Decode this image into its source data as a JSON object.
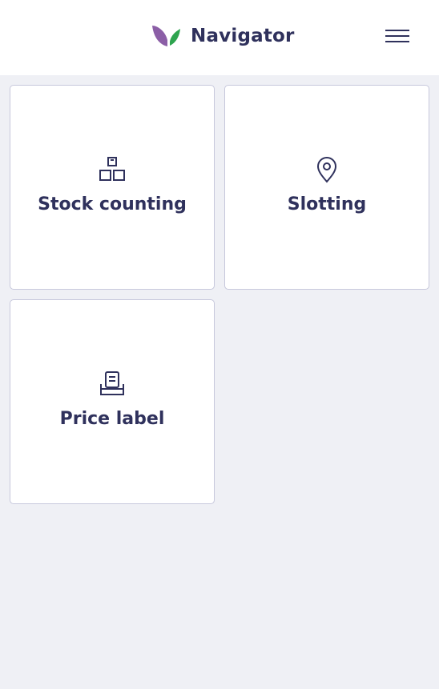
{
  "header": {
    "brand_name": "Navigator",
    "logo_icon": "leaf-logo",
    "menu_icon": "hamburger-menu-icon"
  },
  "tiles": [
    {
      "label": "Stock counting",
      "icon": "boxes-icon"
    },
    {
      "label": "Slotting",
      "icon": "location-pin-icon"
    },
    {
      "label": "Price label",
      "icon": "label-printer-icon"
    }
  ],
  "colors": {
    "brand_purple": "#8b5ea6",
    "brand_green": "#2ea44f",
    "text": "#2f315c",
    "background": "#eff0f5",
    "tile_border": "#c7c8dc"
  }
}
